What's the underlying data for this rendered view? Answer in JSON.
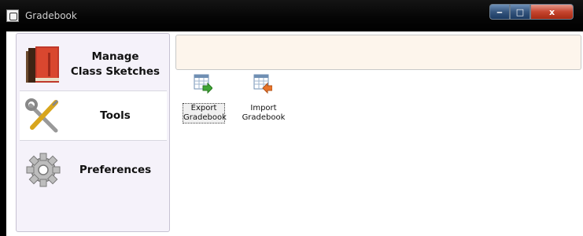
{
  "window": {
    "title": "Gradebook"
  },
  "titlebar_controls": {
    "minimize": "‒",
    "maximize": "□",
    "close": "x"
  },
  "sidebar": {
    "items": [
      {
        "line1": "Manage",
        "line2": "Class Sketches",
        "icon": "books-icon"
      },
      {
        "label": "Tools",
        "icon": "tools-icon"
      },
      {
        "label": "Preferences",
        "icon": "gear-icon"
      }
    ],
    "selected": "Tools"
  },
  "tools": [
    {
      "line1": "Export",
      "line2": "Gradebook",
      "icon": "spreadsheet-export-icon"
    },
    {
      "line1": "Import",
      "line2": "Gradebook",
      "icon": "spreadsheet-import-icon"
    }
  ]
}
